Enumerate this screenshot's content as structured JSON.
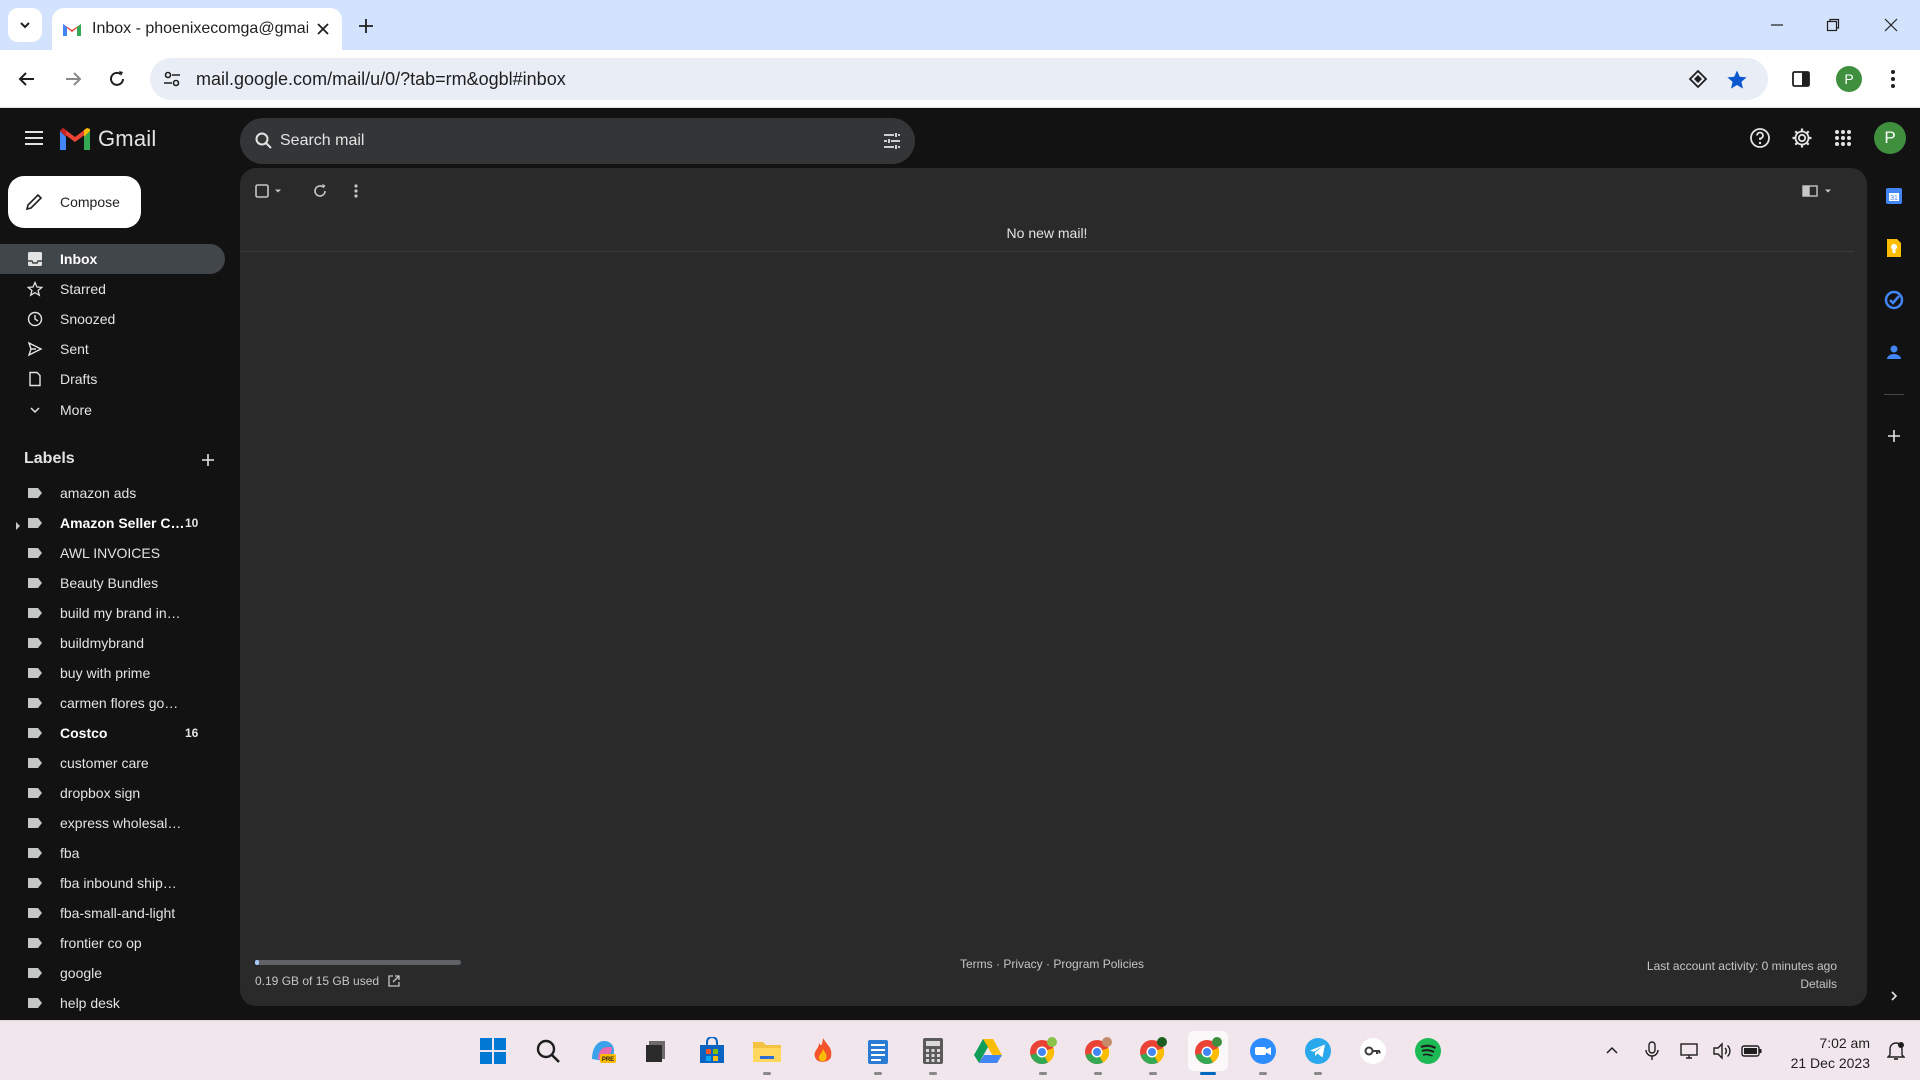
{
  "browser": {
    "tab_title": "Inbox - phoenixecomga@gmail.com",
    "url": "mail.google.com/mail/u/0/?tab=rm&ogbl#inbox",
    "profile_initial": "P"
  },
  "gmail": {
    "app_name": "Gmail",
    "search_placeholder": "Search mail",
    "account_initial": "P",
    "compose_label": "Compose",
    "nav": [
      {
        "label": "Inbox",
        "icon": "inbox-icon",
        "active": true
      },
      {
        "label": "Starred",
        "icon": "star-icon"
      },
      {
        "label": "Snoozed",
        "icon": "clock-icon"
      },
      {
        "label": "Sent",
        "icon": "send-icon"
      },
      {
        "label": "Drafts",
        "icon": "draft-icon"
      },
      {
        "label": "More",
        "icon": "chevron-down-icon"
      }
    ],
    "labels_heading": "Labels",
    "labels": [
      {
        "label": "amazon ads",
        "count": ""
      },
      {
        "label": "Amazon Seller Ce...",
        "count": "10",
        "bold": true
      },
      {
        "label": "AWL INVOICES",
        "count": ""
      },
      {
        "label": "Beauty Bundles",
        "count": ""
      },
      {
        "label": "build my brand invoice",
        "count": ""
      },
      {
        "label": "buildmybrand",
        "count": ""
      },
      {
        "label": "buy with prime",
        "count": ""
      },
      {
        "label": "carmen flores gonza",
        "count": ""
      },
      {
        "label": "Costco",
        "count": "16",
        "bold": true
      },
      {
        "label": "customer care",
        "count": ""
      },
      {
        "label": "dropbox sign",
        "count": ""
      },
      {
        "label": "express wholesale b inv...",
        "count": ""
      },
      {
        "label": "fba",
        "count": ""
      },
      {
        "label": "fba inbound shipment b...",
        "count": ""
      },
      {
        "label": "fba-small-and-light",
        "count": ""
      },
      {
        "label": "frontier co op",
        "count": ""
      },
      {
        "label": "google",
        "count": ""
      },
      {
        "label": "help desk",
        "count": ""
      }
    ],
    "empty_message": "No new mail!",
    "storage": {
      "text": "0.19 GB of 15 GB used",
      "used_gb": 0.19,
      "total_gb": 15
    },
    "footer": {
      "terms": "Terms",
      "privacy": "Privacy",
      "policies": "Program Policies",
      "sep": " · "
    },
    "activity": {
      "line1": "Last account activity: 0 minutes ago",
      "line2": "Details"
    }
  },
  "taskbar": {
    "apps": [
      "windows-start-icon",
      "search-icon",
      "copilot-icon",
      "file-stack-icon",
      "microsoft-store-icon",
      "file-explorer-icon",
      "flame-app-icon",
      "notepad-icon",
      "calculator-icon",
      "google-drive-icon",
      "chrome-profile-1-icon",
      "chrome-profile-2-icon",
      "chrome-profile-3-icon",
      "chrome-profile-4-icon",
      "zoom-icon",
      "telegram-icon",
      "key-app-icon",
      "spotify-icon"
    ],
    "time": "7:02 am",
    "date": "21 Dec 2023"
  },
  "colors": {
    "gmail_red": "#ea4335",
    "accent_blue": "#0b57d0",
    "sidebar_active": "#41464a"
  }
}
